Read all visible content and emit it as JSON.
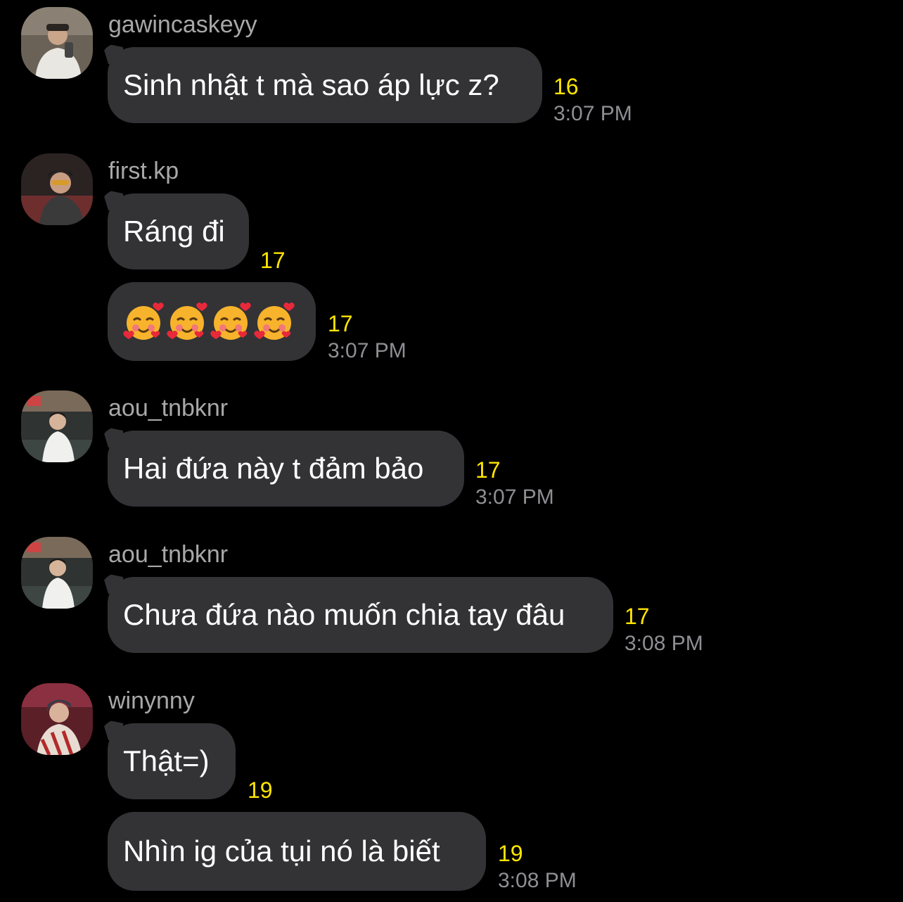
{
  "messages": [
    {
      "sender": "gawincaskeyy",
      "bubbles": [
        {
          "text": "Sinh nhật t mà sao áp lực z?",
          "count": "16",
          "time": "3:07 PM"
        }
      ]
    },
    {
      "sender": "first.kp",
      "bubbles": [
        {
          "text": "Ráng đi",
          "count": "17",
          "time": ""
        },
        {
          "text": "🥰🥰🥰🥰",
          "count": "17",
          "time": "3:07 PM"
        }
      ]
    },
    {
      "sender": "aou_tnbknr",
      "bubbles": [
        {
          "text": "Hai đứa này t đảm bảo",
          "count": "17",
          "time": "3:07 PM"
        }
      ]
    },
    {
      "sender": "aou_tnbknr",
      "bubbles": [
        {
          "text": "Chưa đứa nào muốn chia tay đâu",
          "count": "17",
          "time": "3:08 PM"
        }
      ]
    },
    {
      "sender": "winynny",
      "bubbles": [
        {
          "text": "Thật=)",
          "count": "19",
          "time": ""
        },
        {
          "text": "Nhìn ig của tụi nó là biết",
          "count": "19",
          "time": "3:08 PM"
        }
      ]
    }
  ],
  "colors": {
    "background": "#000000",
    "bubble": "#333336",
    "message_text": "#ffffff",
    "sender_text": "#a8a8a8",
    "count_text": "#ffe500",
    "time_text": "#8e8e93"
  },
  "icons": {
    "avatar": "user-photo",
    "emoji": "smiling-face-with-hearts"
  }
}
